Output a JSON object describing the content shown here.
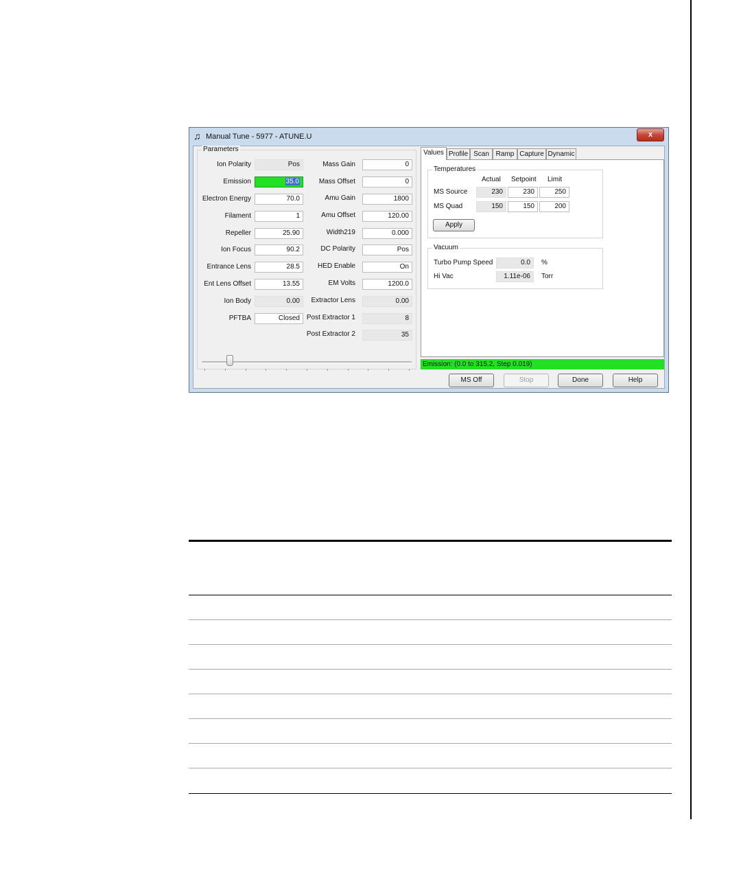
{
  "window": {
    "title": "Manual Tune - 5977 - ATUNE.U",
    "icon": "music-note-icon",
    "close_label": "x"
  },
  "parameters": {
    "group_label": "Parameters",
    "left": [
      {
        "label": "Ion Polarity",
        "value": "Pos",
        "state": "readonly"
      },
      {
        "label": "Emission",
        "value": "35.0",
        "state": "selected"
      },
      {
        "label": "Electron Energy",
        "value": "70.0",
        "state": "editable"
      },
      {
        "label": "Filament",
        "value": "1",
        "state": "editable"
      },
      {
        "label": "Repeller",
        "value": "25.90",
        "state": "editable"
      },
      {
        "label": "Ion Focus",
        "value": "90.2",
        "state": "editable"
      },
      {
        "label": "Entrance Lens",
        "value": "28.5",
        "state": "editable"
      },
      {
        "label": "Ent Lens Offset",
        "value": "13.55",
        "state": "editable"
      },
      {
        "label": "Ion Body",
        "value": "0.00",
        "state": "readonly"
      },
      {
        "label": "PFTBA",
        "value": "Closed",
        "state": "editable"
      }
    ],
    "right": [
      {
        "label": "Mass Gain",
        "value": "0",
        "state": "editable"
      },
      {
        "label": "Mass Offset",
        "value": "0",
        "state": "editable"
      },
      {
        "label": "Amu Gain",
        "value": "1800",
        "state": "editable"
      },
      {
        "label": "Amu Offset",
        "value": "120.00",
        "state": "editable"
      },
      {
        "label": "Width219",
        "value": "0.000",
        "state": "editable"
      },
      {
        "label": "DC Polarity",
        "value": "Pos",
        "state": "editable"
      },
      {
        "label": "HED Enable",
        "value": "On",
        "state": "editable"
      },
      {
        "label": "EM Volts",
        "value": "1200.0",
        "state": "editable"
      },
      {
        "label": "Extractor Lens",
        "value": "0.00",
        "state": "readonly"
      },
      {
        "label": "Post Extractor 1",
        "value": "8",
        "state": "readonly"
      },
      {
        "label": "Post Extractor 2",
        "value": "35",
        "state": "readonly"
      }
    ]
  },
  "tabs": [
    {
      "label": "Values",
      "active": true
    },
    {
      "label": "Profile",
      "active": false
    },
    {
      "label": "Scan",
      "active": false
    },
    {
      "label": "Ramp",
      "active": false
    },
    {
      "label": "Capture",
      "active": false
    },
    {
      "label": "Dynamic",
      "active": false
    }
  ],
  "temperatures": {
    "group_label": "Temperatures",
    "columns": [
      "Actual",
      "Setpoint",
      "Limit"
    ],
    "rows": [
      {
        "label": "MS Source",
        "actual": "230",
        "setpoint": "230",
        "limit": "250"
      },
      {
        "label": "MS Quad",
        "actual": "150",
        "setpoint": "150",
        "limit": "200"
      }
    ],
    "apply_label": "Apply"
  },
  "vacuum": {
    "group_label": "Vacuum",
    "rows": [
      {
        "label": "Turbo Pump Speed",
        "value": "0.0",
        "unit": "%"
      },
      {
        "label": "Hi Vac",
        "value": "1.11e-06",
        "unit": "Torr"
      }
    ]
  },
  "status_text": "Emission: (0.0 to 315.2, Step 0.019)",
  "buttons": {
    "ms_off": "MS Off",
    "stop": "Stop",
    "done": "Done",
    "help": "Help"
  },
  "slider": {
    "value_fraction": 0.12
  }
}
